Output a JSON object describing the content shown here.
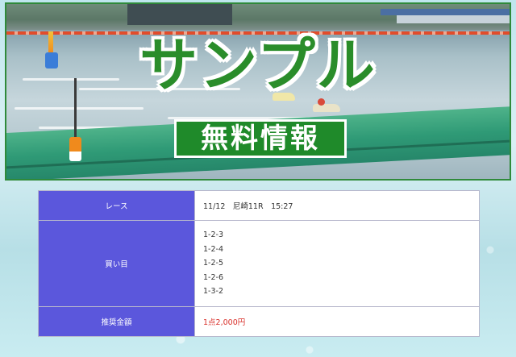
{
  "banner": {
    "title": "サンプル",
    "subtitle": "無料情報"
  },
  "info_table": {
    "race": {
      "label": "レース",
      "value": "11/12　尼崎11R　15:27"
    },
    "bets": {
      "label": "買い目",
      "items": [
        "1-2-3",
        "1-2-4",
        "1-2-5",
        "1-2-6",
        "1-3-2"
      ]
    },
    "amount": {
      "label": "推奨金額",
      "value": "1点2,000円"
    }
  },
  "colors": {
    "banner_green": "#2a8d2a",
    "header_cell": "#5b57dc",
    "amount_red": "#d9312b"
  }
}
